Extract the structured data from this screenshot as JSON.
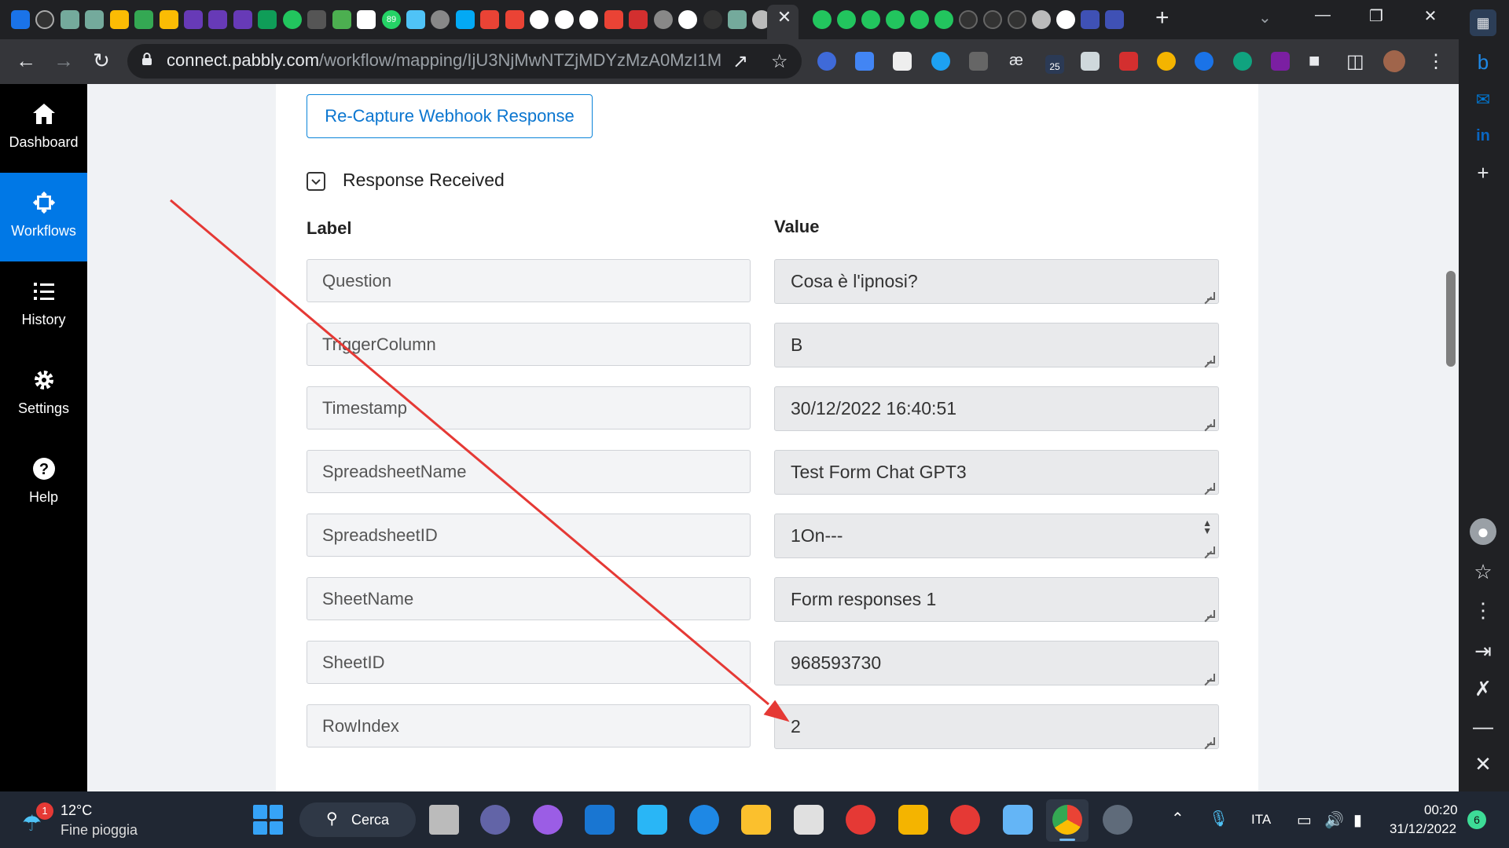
{
  "browser": {
    "url_domain": "connect.pabbly.com",
    "url_path": "/workflow/mapping/IjU3NjMwNTZjMDYzMzA0MzI1M...",
    "tab_close": "✕",
    "new_tab": "+",
    "ext_badge": "25",
    "tab_badge": "89"
  },
  "nav": {
    "items": [
      {
        "label": "Dashboard",
        "icon": "home-icon"
      },
      {
        "label": "Workflows",
        "icon": "workflows-icon"
      },
      {
        "label": "History",
        "icon": "history-icon"
      },
      {
        "label": "Settings",
        "icon": "gear-icon"
      },
      {
        "label": "Help",
        "icon": "help-icon"
      }
    ],
    "active": "Workflows"
  },
  "main": {
    "recapture_button": "Re-Capture Webhook Response",
    "response_title": "Response Received",
    "col_label": "Label",
    "col_value": "Value",
    "rows": [
      {
        "label": "Question",
        "value": "Cosa è l'ipnosi?"
      },
      {
        "label": "TriggerColumn",
        "value": "B"
      },
      {
        "label": "Timestamp",
        "value": "30/12/2022 16:40:51"
      },
      {
        "label": "SpreadsheetName",
        "value": "Test Form Chat GPT3"
      },
      {
        "label": "SpreadsheetID",
        "value": "1On---"
      },
      {
        "label": "SheetName",
        "value": "Form responses 1"
      },
      {
        "label": "SheetID",
        "value": "968593730"
      },
      {
        "label": "RowIndex",
        "value": "2"
      }
    ]
  },
  "annotation": {
    "color": "#e53935"
  },
  "taskbar": {
    "weather_temp": "12°C",
    "weather_desc": "Fine pioggia",
    "weather_badge": "1",
    "search_label": "Cerca",
    "language": "ITA",
    "time": "00:20",
    "date": "31/12/2022",
    "notification_count": "6"
  },
  "colors": {
    "accent": "#0078e6",
    "button_text": "#0b76d0",
    "arrow": "#e53935"
  }
}
